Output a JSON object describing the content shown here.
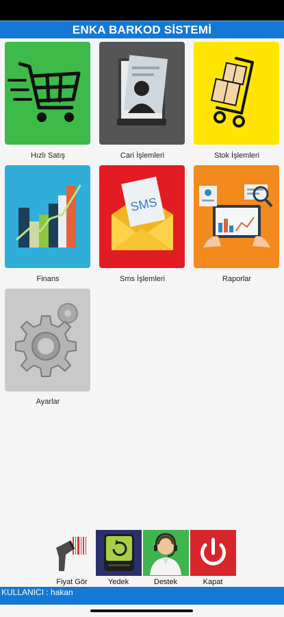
{
  "app": {
    "title": "ENKA BARKOD SİSTEMİ"
  },
  "colors": {
    "title_bar": "#1378d6",
    "tile_hizli_satis": "#3dba4a",
    "tile_cari": "#555555",
    "tile_stok": "#ffe500",
    "tile_finans": "#2eaed8",
    "tile_sms": "#e31b23",
    "tile_raporlar": "#f28a1e",
    "tile_ayarlar": "#c9c9c9"
  },
  "tiles": [
    {
      "label": "Hızlı Satış",
      "icon": "shopping-cart-icon"
    },
    {
      "label": "Cari İşlemleri",
      "icon": "contact-folder-icon"
    },
    {
      "label": "Stok İşlemleri",
      "icon": "hand-truck-icon"
    },
    {
      "label": "Finans",
      "icon": "bar-chart-icon"
    },
    {
      "label": "Sms İşlemleri",
      "icon": "sms-envelope-icon"
    },
    {
      "label": "Raporlar",
      "icon": "report-tablet-icon"
    },
    {
      "label": "Ayarlar",
      "icon": "gears-icon"
    }
  ],
  "bottom_actions": [
    {
      "label": "Fiyat Gör",
      "icon": "barcode-scanner-icon"
    },
    {
      "label": "Yedek",
      "icon": "backup-drive-icon"
    },
    {
      "label": "Destek",
      "icon": "support-agent-icon"
    },
    {
      "label": "Kapat",
      "icon": "power-icon"
    }
  ],
  "footer": {
    "user_text": "KULLANICI : hakan"
  }
}
